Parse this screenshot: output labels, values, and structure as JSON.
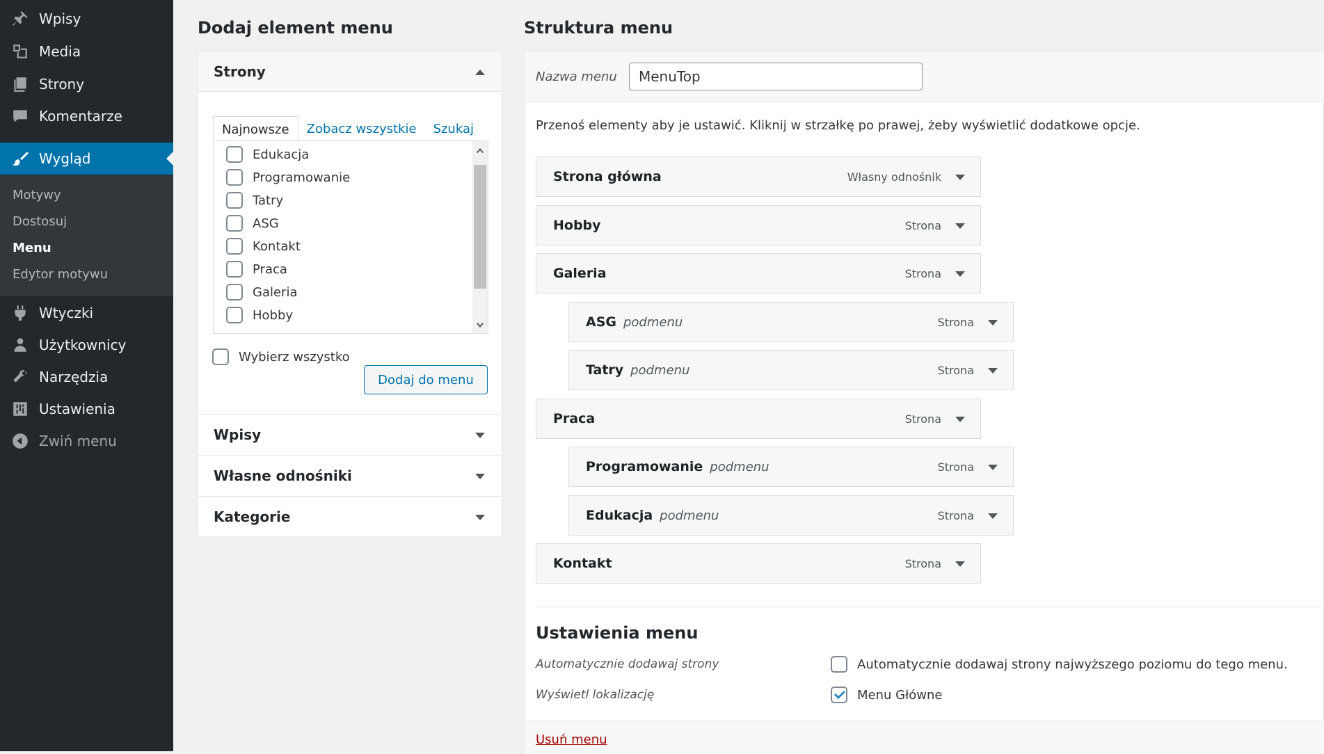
{
  "sidebar": {
    "top_items": [
      {
        "label": "Wpisy",
        "icon": "pin-icon"
      },
      {
        "label": "Media",
        "icon": "media-icon"
      },
      {
        "label": "Strony",
        "icon": "pages-icon"
      },
      {
        "label": "Komentarze",
        "icon": "comments-icon"
      }
    ],
    "active_item": {
      "label": "Wygląd",
      "icon": "brush-icon"
    },
    "submenu": [
      "Motywy",
      "Dostosuj",
      "Menu",
      "Edytor motywu"
    ],
    "current_submenu": "Menu",
    "bottom_items": [
      {
        "label": "Wtyczki",
        "icon": "plugin-icon"
      },
      {
        "label": "Użytkownicy",
        "icon": "users-icon"
      },
      {
        "label": "Narzędzia",
        "icon": "tools-icon"
      },
      {
        "label": "Ustawienia",
        "icon": "settings-icon"
      }
    ],
    "collapse_label": "Zwiń menu"
  },
  "add_section": {
    "title": "Dodaj element menu",
    "pages_box": {
      "title": "Strony",
      "tabs": [
        "Najnowsze",
        "Zobacz wszystkie",
        "Szukaj"
      ],
      "active_tab": "Najnowsze",
      "pages": [
        "Edukacja",
        "Programowanie",
        "Tatry",
        "ASG",
        "Kontakt",
        "Praca",
        "Galeria",
        "Hobby"
      ],
      "select_all": "Wybierz wszystko",
      "add_button": "Dodaj do menu"
    },
    "other_boxes": [
      "Wpisy",
      "Własne odnośniki",
      "Kategorie"
    ]
  },
  "structure": {
    "title": "Struktura menu",
    "menu_name_label": "Nazwa menu",
    "menu_name_value": "MenuTop",
    "instructions": "Przenoś elementy aby je ustawić. Kliknij w strzałkę po prawej, żeby wyświetlić dodatkowe opcje.",
    "items": [
      {
        "title": "Strona główna",
        "type": "Własny odnośnik",
        "depth": 0,
        "sub": ""
      },
      {
        "title": "Hobby",
        "type": "Strona",
        "depth": 0,
        "sub": ""
      },
      {
        "title": "Galeria",
        "type": "Strona",
        "depth": 0,
        "sub": ""
      },
      {
        "title": "ASG",
        "type": "Strona",
        "depth": 1,
        "sub": "podmenu"
      },
      {
        "title": "Tatry",
        "type": "Strona",
        "depth": 1,
        "sub": "podmenu"
      },
      {
        "title": "Praca",
        "type": "Strona",
        "depth": 0,
        "sub": ""
      },
      {
        "title": "Programowanie",
        "type": "Strona",
        "depth": 1,
        "sub": "podmenu"
      },
      {
        "title": "Edukacja",
        "type": "Strona",
        "depth": 1,
        "sub": "podmenu"
      },
      {
        "title": "Kontakt",
        "type": "Strona",
        "depth": 0,
        "sub": ""
      }
    ]
  },
  "settings": {
    "title": "Ustawienia menu",
    "auto_add_label": "Automatycznie dodawaj strony",
    "auto_add_option": "Automatycznie dodawaj strony najwyższego poziomu do tego menu.",
    "auto_add_checked": false,
    "location_label": "Wyświetl lokalizację",
    "location_option": "Menu Główne",
    "location_checked": true,
    "delete_link": "Usuń menu"
  },
  "colors": {
    "sidebar_bg": "#23282d",
    "accent": "#0073aa",
    "delete": "#aa0000"
  }
}
